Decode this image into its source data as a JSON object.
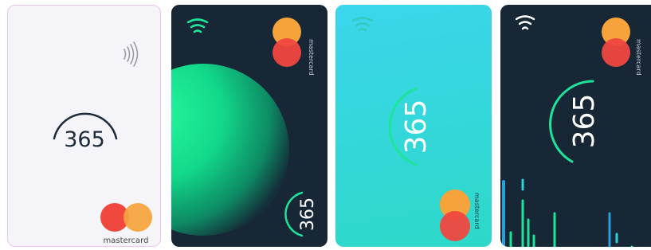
{
  "cards": [
    {
      "brand_text": "mastercard",
      "number_text": "365",
      "contactless_icon": "contactless-icon",
      "logo_icon": "mastercard-logo-icon",
      "background": "#f4f4f9"
    },
    {
      "brand_text": "mastercard",
      "number_text": "365",
      "contactless_icon": "contactless-icon",
      "logo_icon": "mastercard-logo-icon",
      "background": "#172735"
    },
    {
      "brand_text": "mastercard",
      "number_text": "365",
      "contactless_icon": "contactless-icon",
      "logo_icon": "mastercard-logo-icon",
      "background": "#3bd6ec"
    },
    {
      "brand_text": "mastercard",
      "number_text": "365",
      "contactless_icon": "contactless-icon",
      "logo_icon": "mastercard-logo-icon",
      "background": "#172735"
    }
  ],
  "colors": {
    "mastercard_red": "#f0473f",
    "mastercard_orange": "#f6a33b",
    "accent_green": "#1ee49a",
    "accent_blue": "#2b9fd8",
    "navy": "#172735"
  }
}
